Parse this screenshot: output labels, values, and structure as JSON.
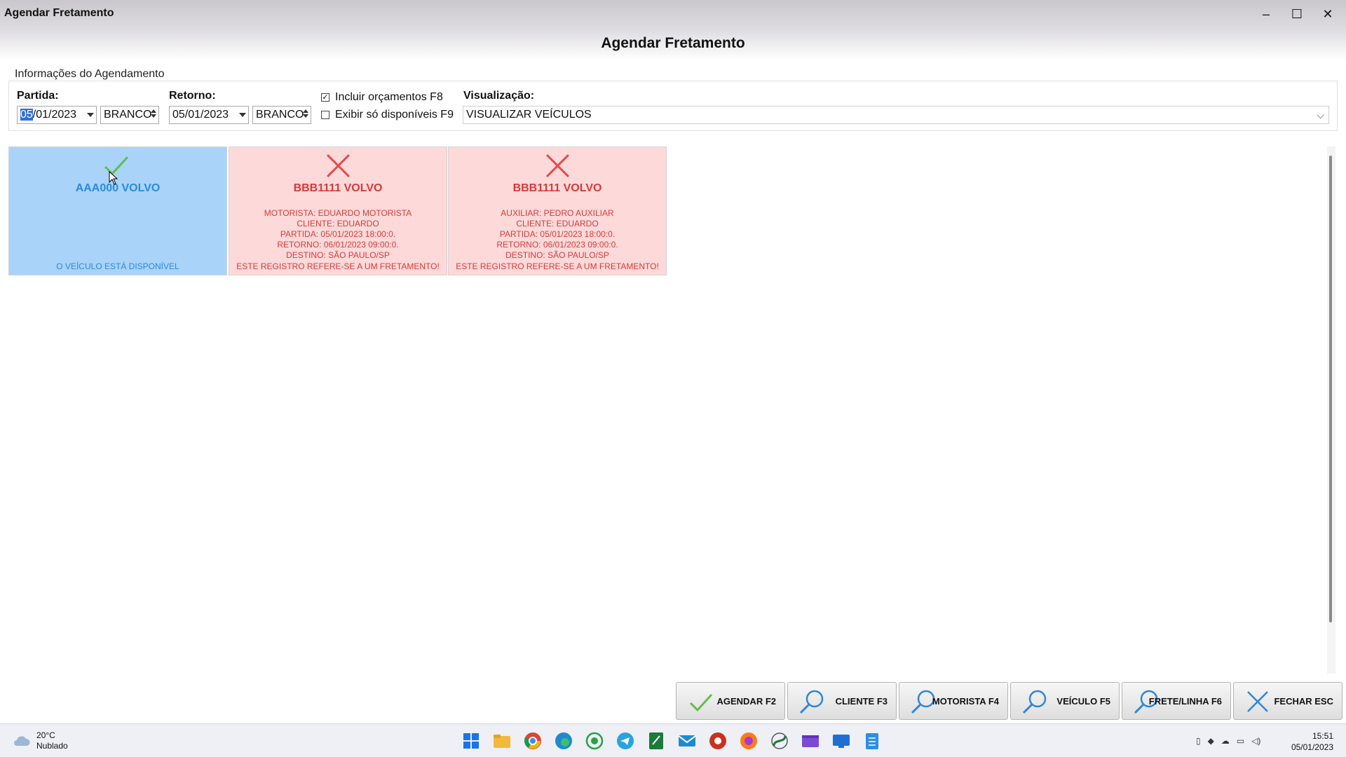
{
  "window": {
    "title": "Agendar Fretamento",
    "controls": [
      "–",
      "☐",
      "✕"
    ]
  },
  "page_title": "Agendar Fretamento",
  "group": {
    "legend": "Informações do Agendamento",
    "partida": {
      "label": "Partida:",
      "date_selected": "05",
      "date_rest": "/01/2023",
      "color": "BRANCO"
    },
    "retorno": {
      "label": "Retorno:",
      "date": "05/01/2023",
      "color": "BRANCO"
    },
    "checkbox_orcamentos": {
      "label": "Incluir orçamentos F8",
      "checked": true,
      "mark": "✓"
    },
    "checkbox_disponiveis": {
      "label": "Exibir só disponíveis F9",
      "checked": false
    },
    "visualizacao": {
      "label": "Visualização:",
      "value": "VISUALIZAR VEÍCULOS"
    }
  },
  "cards": [
    {
      "status": "available",
      "icon": "check-icon",
      "title": "AAA000 VOLVO",
      "details": [],
      "footer": "O VEÍCULO ESTÁ DISPONÍVEL"
    },
    {
      "status": "unavailable",
      "icon": "cross-icon",
      "title": "BBB1111 VOLVO",
      "details": [
        "MOTORISTA: EDUARDO MOTORISTA",
        "CLIENTE: EDUARDO",
        "PARTIDA: 05/01/2023 18:00:0.",
        "RETORNO: 06/01/2023 09:00:0.",
        "DESTINO: SÃO PAULO/SP"
      ],
      "footer": "ESTE REGISTRO REFERE-SE A UM FRETAMENTO!"
    },
    {
      "status": "unavailable",
      "icon": "cross-icon",
      "title": "BBB1111 VOLVO",
      "details": [
        "AUXILIAR: PEDRO AUXILIAR",
        "CLIENTE: EDUARDO",
        "PARTIDA: 05/01/2023 18:00:0.",
        "RETORNO: 06/01/2023 09:00:0.",
        "DESTINO: SÃO PAULO/SP"
      ],
      "footer": "ESTE REGISTRO REFERE-SE A UM FRETAMENTO!"
    }
  ],
  "buttons": {
    "agendar": "AGENDAR F2",
    "cliente": "CLIENTE F3",
    "motorista": "MOTORISTA F4",
    "veiculo": "VEÍCULO F5",
    "frete_linha": "FRETE/LINHA F6",
    "fechar": "FECHAR ESC"
  },
  "taskbar": {
    "weather_temp": "20°C",
    "weather_desc": "Nublado",
    "time": "15:51",
    "date": "05/01/2023"
  },
  "colors": {
    "available_bg": "#a9d3f9",
    "available_fg": "#2a8bd8",
    "unavailable_bg": "#fdd9d9",
    "unavailable_fg": "#d43b3b",
    "check_green": "#5fbf4a",
    "cross_red": "#e34b4b",
    "search_blue": "#2f86d8"
  }
}
